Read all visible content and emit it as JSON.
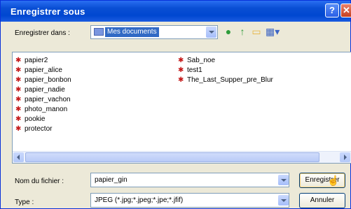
{
  "window": {
    "title": "Enregistrer sous"
  },
  "lookin": {
    "label": "Enregistrer dans :",
    "value": "Mes documents"
  },
  "toolbar": {
    "back_icon": "back-arrow-icon",
    "up_icon": "up-folder-icon",
    "newfolder_icon": "new-folder-icon",
    "views_icon": "views-menu-icon"
  },
  "files": {
    "col1": [
      "papier2",
      "papier_alice",
      "papier_bonbon",
      "papier_nadie",
      "papier_vachon",
      "photo_manon",
      "pookie",
      "protector"
    ],
    "col2": [
      "Sab_noe",
      "test1",
      "The_Last_Supper_pre_Blur"
    ]
  },
  "filename": {
    "label": "Nom du fichier :",
    "value": "papier_gin"
  },
  "filetype": {
    "label": "Type :",
    "value": "JPEG (*.jpg;*.jpeg;*.jpe;*.jfif)"
  },
  "buttons": {
    "save": "Enregistrer",
    "cancel": "Annuler"
  },
  "colors": {
    "title_bar": "#0a4fd4",
    "selection": "#316ac5",
    "dialog_bg": "#ece9d8",
    "file_icon": "#c41818"
  }
}
